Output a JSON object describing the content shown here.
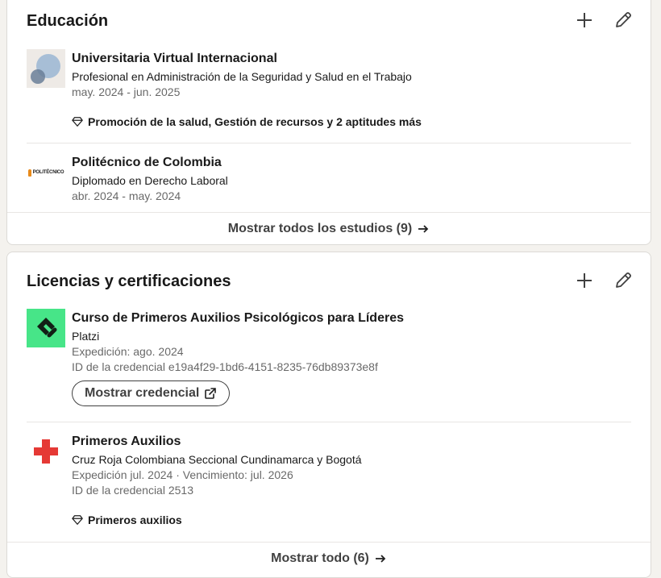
{
  "education": {
    "title": "Educación",
    "items": [
      {
        "school": "Universitaria Virtual Internacional",
        "degree": "Profesional en Administración de la Seguridad y Salud en el Trabajo",
        "dates": "may. 2024 - jun. 2025",
        "skills": "Promoción de la salud, Gestión de recursos y 2 aptitudes más"
      },
      {
        "school": "Politécnico de Colombia",
        "degree": "Diplomado en Derecho Laboral",
        "dates": "abr. 2024 - may. 2024",
        "logo_text": "POLITÉCNICO"
      }
    ],
    "show_all": "Mostrar todos los estudios (9)"
  },
  "licenses": {
    "title": "Licencias y certificaciones",
    "items": [
      {
        "name": "Curso de Primeros Auxilios Psicológicos para Líderes",
        "issuer": "Platzi",
        "issued": "Expedición: ago. 2024",
        "credential_id": "ID de la credencial e19a4f29-1bd6-4151-8235-76db89373e8f",
        "button": "Mostrar credencial"
      },
      {
        "name": "Primeros Auxilios",
        "issuer": "Cruz Roja Colombiana Seccional Cundinamarca y Bogotá",
        "issued": "Expedición jul. 2024 · Vencimiento: jul. 2026",
        "credential_id": "ID de la credencial 2513",
        "skills": "Primeros auxilios"
      }
    ],
    "show_all": "Mostrar todo (6)"
  },
  "colors": {
    "platzi_green": "#98ca3f",
    "red_cross": "#e53935",
    "text_primary": "#1f1f1f",
    "text_secondary": "#666666"
  },
  "icons": [
    "plus-icon",
    "pencil-icon",
    "diamond-icon",
    "arrow-right-icon",
    "external-link-icon"
  ]
}
